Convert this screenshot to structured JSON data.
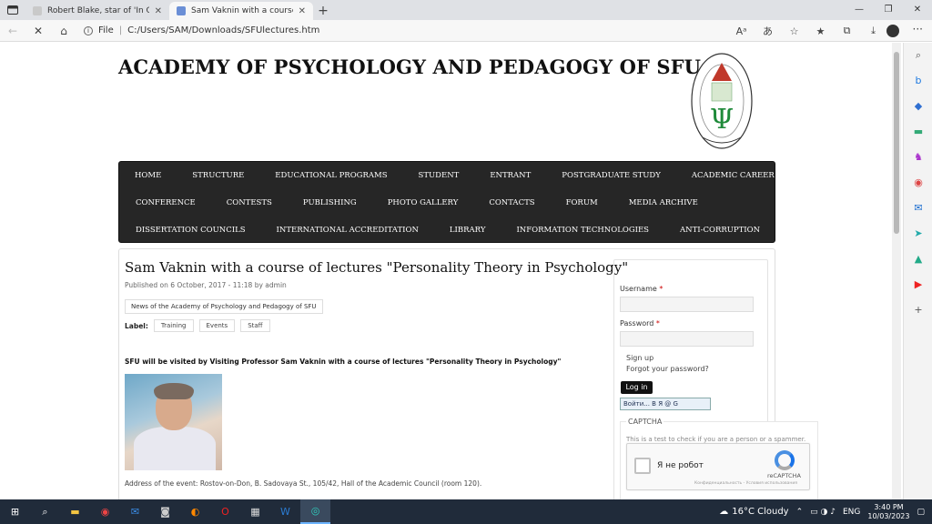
{
  "browser": {
    "tabs": [
      {
        "label": "Robert Blake, star of 'In Cold Blo",
        "active": false
      },
      {
        "label": "Sam Vaknin with a course of lectu",
        "active": true
      }
    ],
    "address": {
      "scheme": "File",
      "path": "C:/Users/SAM/Downloads/SFUlectures.htm"
    }
  },
  "site": {
    "title": "ACADEMY OF PSYCHOLOGY AND PEDAGOGY OF SFU",
    "logo_letter": "Ψ"
  },
  "nav": {
    "row1": [
      "HOME",
      "STRUCTURE",
      "EDUCATIONAL PROGRAMS",
      "STUDENT",
      "ENTRANT",
      "POSTGRADUATE STUDY",
      "ACADEMIC CAREER"
    ],
    "row2": [
      "CONFERENCE",
      "CONTESTS",
      "PUBLISHING",
      "PHOTO GALLERY",
      "CONTACTS",
      "FORUM",
      "MEDIA ARCHIVE"
    ],
    "row3": [
      "DISSERTATION COUNCILS",
      "INTERNATIONAL ACCREDITATION",
      "LIBRARY",
      "INFORMATION TECHNOLOGIES",
      "ANTI-CORRUPTION"
    ]
  },
  "article": {
    "title": "Sam Vaknin with a course of lectures \"Personality Theory in Psychology\"",
    "published": "Published on 6 October, 2017 - 11:18 by admin",
    "category": "News of the Academy of Psychology and Pedagogy of SFU",
    "label_title": "Label:",
    "tags": [
      "Training",
      "Events",
      "Staff"
    ],
    "intro": "SFU will be visited by Visiting Professor Sam Vaknin with a course of lectures \"Personality Theory in Psychology\"",
    "address": "Address of the event: Rostov-on-Don, B. Sadovaya St., 105/42, Hall of the Academic Council (room 120)."
  },
  "login": {
    "username_label": "Username",
    "password_label": "Password",
    "required_mark": "*",
    "signup": "Sign up",
    "forgot": "Forgot your password?",
    "login_button": "Log in",
    "social_text": "Войти... В Я @ G"
  },
  "captcha": {
    "title": "CAPTCHA",
    "note": "This is a test to check if you are a person or a spammer.",
    "checkbox_label": "Я не робот",
    "brand": "reCAPTCHA",
    "terms": "Конфиденциальность - Условия использования"
  },
  "taskbar": {
    "weather": "16°C Cloudy",
    "lang": "ENG",
    "time": "3:40 PM",
    "date": "10/03/2023"
  }
}
